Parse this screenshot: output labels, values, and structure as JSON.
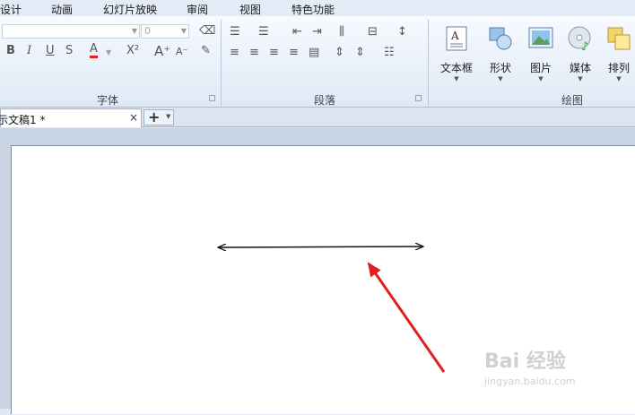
{
  "menu": [
    "设计",
    "动画",
    "幻灯片放映",
    "审阅",
    "视图",
    "特色功能"
  ],
  "ribbon": {
    "font_group": {
      "label": "字体",
      "font_name_value": "",
      "font_size_value": "0",
      "buttons": [
        "B",
        "I",
        "U",
        "S",
        "A",
        "X²",
        "A⁺",
        "A⁻"
      ]
    },
    "paragraph_group": {
      "label": "段落"
    },
    "drawing_group": {
      "label": "绘图",
      "buttons": [
        {
          "label": "文本框",
          "icon": "textbox-icon"
        },
        {
          "label": "形状",
          "icon": "shapes-icon"
        },
        {
          "label": "图片",
          "icon": "picture-icon"
        },
        {
          "label": "媒体",
          "icon": "media-icon"
        },
        {
          "label": "排列",
          "icon": "arrange-icon"
        }
      ]
    }
  },
  "tabs": {
    "document_title": "示文稿1 *",
    "close_symbol": "×",
    "new_tab_symbol": "+"
  },
  "watermark": {
    "brand": "Bai 经验",
    "url": "jingyan.baidu.com"
  },
  "colors": {
    "arrow_annotation": "#e02020",
    "line": "#111111"
  }
}
